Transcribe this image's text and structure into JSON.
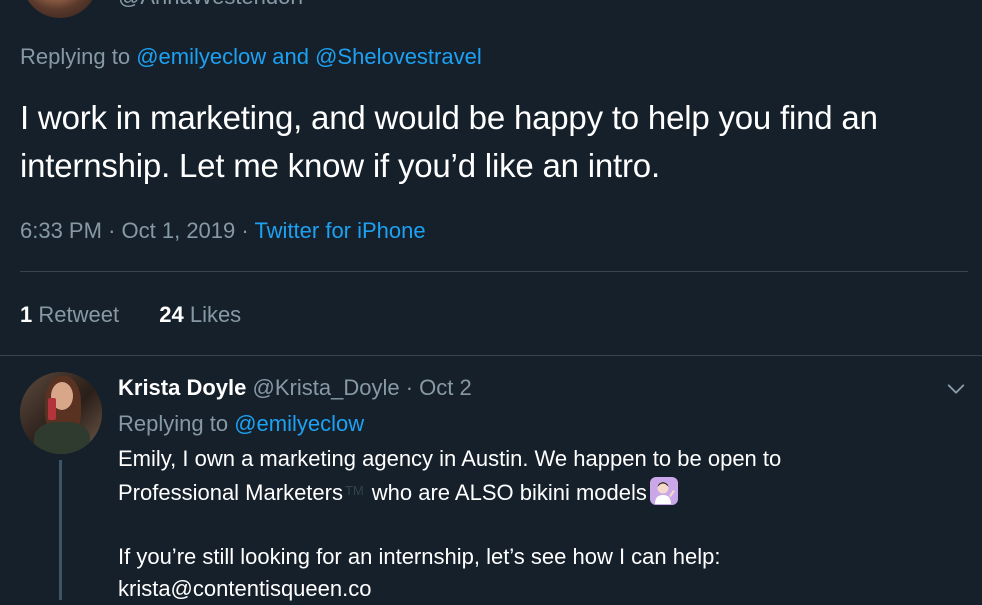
{
  "top_tweet": {
    "author_handle": "@AnnaWestendorf",
    "replying_label": "Replying to",
    "replying_to": [
      "@emilyeclow",
      "@Shelovestravel"
    ],
    "replying_joiner": "and",
    "text": "I work in marketing, and would be happy to help you find an internship. Let me know if you’d like an intro.",
    "time": "6:33 PM",
    "date": "Oct 1, 2019",
    "separator": "·",
    "source": "Twitter for iPhone",
    "stats": {
      "retweets_count": "1",
      "retweets_label": "Retweet",
      "likes_count": "24",
      "likes_label": "Likes"
    }
  },
  "reply_tweet": {
    "name": "Krista Doyle",
    "handle": "@Krista_Doyle",
    "separator": "·",
    "date": "Oct 2",
    "replying_label": "Replying to",
    "replying_to": "@emilyeclow",
    "lines": [
      "Emily, I own a marketing agency in Austin. We happen to be open to",
      "Professional Marketers",
      "who are ALSO bikini models",
      "If you’re still looking for an internship, let’s see how I can help:",
      "krista@contentisqueen.co"
    ],
    "trademark": "TM",
    "emoji": "person-tipping-hand-icon"
  },
  "colors": {
    "background": "#15202b",
    "text": "#ffffff",
    "muted": "#8899a6",
    "link": "#1da1f2",
    "divider": "#38444d"
  }
}
